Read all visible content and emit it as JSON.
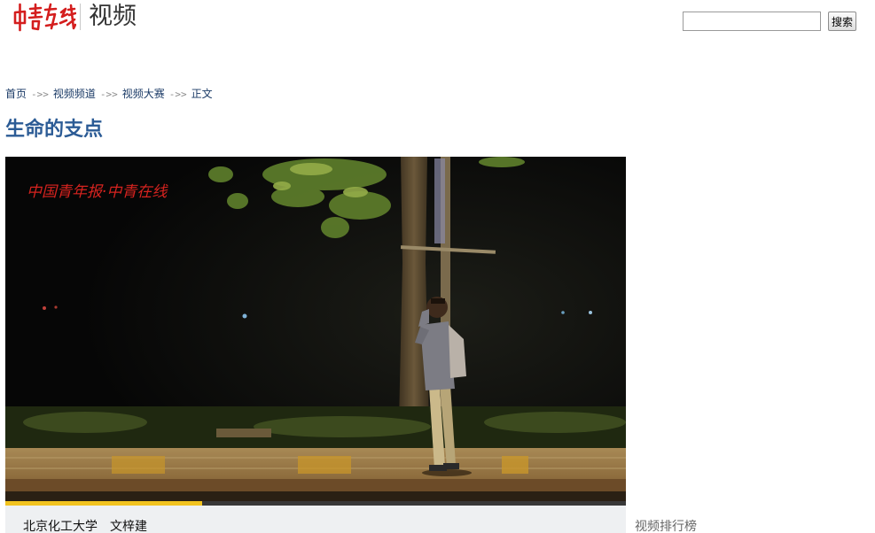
{
  "header": {
    "logo_alt": "中青在线",
    "section_title": "视频"
  },
  "search": {
    "placeholder": "",
    "value": "",
    "button_label": "搜索"
  },
  "breadcrumb": {
    "items": [
      "首页",
      "视频频道",
      "视频大赛",
      "正文"
    ],
    "separator": "->>"
  },
  "article": {
    "title": "生命的支点"
  },
  "video": {
    "watermark": "中国青年报·中青在线",
    "progress_percent": 31.7
  },
  "caption": {
    "text": "北京化工大学　文梓建"
  },
  "sidebar": {
    "ranking_title": "视频排行榜"
  },
  "colors": {
    "title_blue": "#2b5b95",
    "link_navy": "#1a3a66",
    "logo_red": "#d41e1e",
    "progress_yellow": "#f2c31f"
  }
}
